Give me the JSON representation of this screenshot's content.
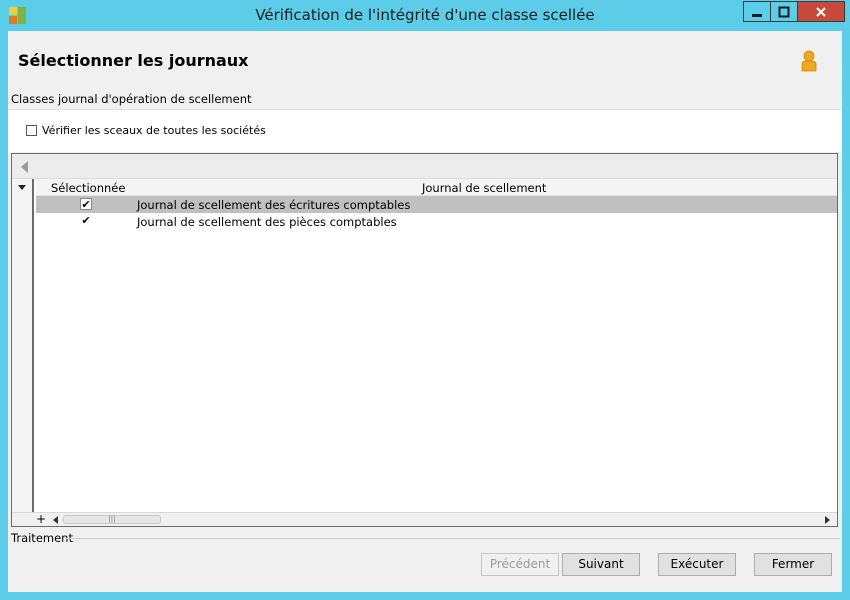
{
  "window": {
    "title": "Vérification de l'intégrité d'une classe scellée"
  },
  "header": {
    "title": "Sélectionner les journaux"
  },
  "sections": {
    "journal_classes": "Classes journal d'opération de scellement",
    "treatment": "Traitement"
  },
  "options": {
    "verify_all_companies": {
      "label": "Vérifier les sceaux de toutes les sociétés",
      "checked": false
    }
  },
  "grid": {
    "columns": [
      "Sélectionnée",
      "Journal de scellement"
    ],
    "rows": [
      {
        "selected": true,
        "selected_mark": "✔",
        "journal": "Journal de scellement des écritures comptables"
      },
      {
        "selected": true,
        "selected_mark": "✔",
        "journal": "Journal de scellement des pièces comptables"
      }
    ],
    "add_glyph": "+",
    "scroll_thumb_grip": "|||"
  },
  "buttons": {
    "previous": "Précédent",
    "next": "Suivant",
    "execute": "Exécuter",
    "close": "Fermer"
  },
  "icons": {
    "app": "app-logo-icon",
    "user": "user-icon",
    "minimize": "minimize-icon",
    "maximize": "maximize-icon",
    "close": "close-icon"
  },
  "colors": {
    "titlebar": "#5ccde9",
    "close_button": "#c74a3b",
    "selected_row": "#c0c0c0",
    "user_icon": "#f2a81d"
  }
}
